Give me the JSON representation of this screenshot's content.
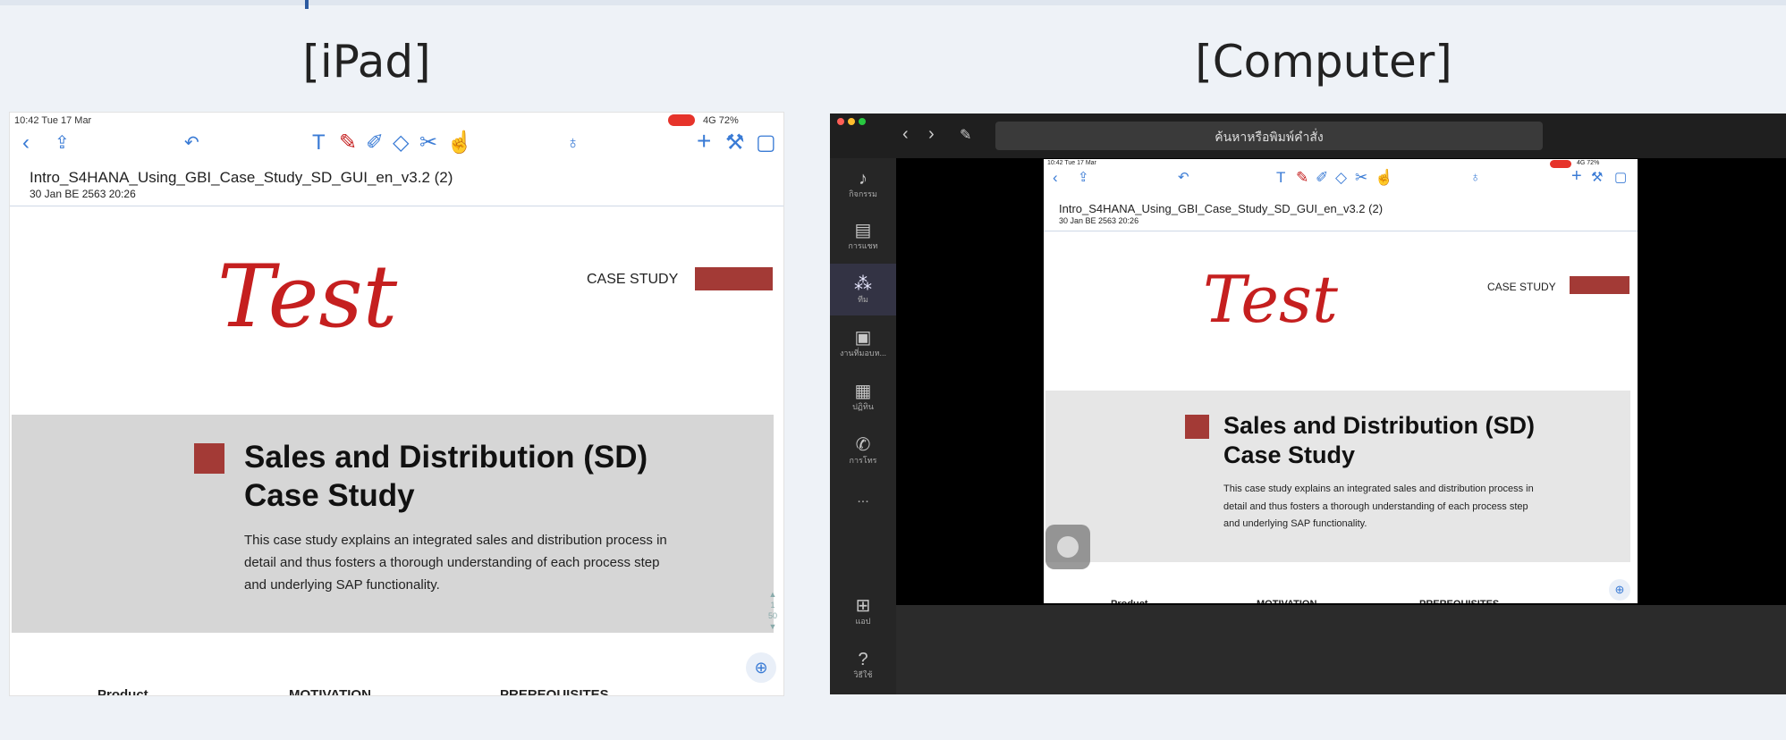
{
  "headings": {
    "ipad": "[iPad]",
    "computer": "[Computer]"
  },
  "ipad": {
    "status_time": "10:42  Tue 17 Mar",
    "status_right": "4G 72%",
    "doc_title": "Intro_S4HANA_Using_GBI_Case_Study_SD_GUI_en_v3.2 (2)",
    "doc_date": "30 Jan BE 2563 20:26",
    "handwriting": "Test",
    "case_study_label": "CASE STUDY",
    "title_line1": "Sales and Distribution (SD)",
    "title_line2": "Case Study",
    "body_line1": "This case study explains an integrated sales and distribution process in",
    "body_line2": "detail and thus fosters a thorough understanding of each process step",
    "body_line3": "and underlying SAP functionality.",
    "page_indicator_top": "1",
    "page_indicator_bottom": "50",
    "footer_col1": "Product",
    "footer_col2": "MOTIVATION",
    "footer_col3": "PREREQUISITES"
  },
  "teams": {
    "search_placeholder": "ค้นหาหรือพิมพ์คำสั่ง",
    "sidebar": [
      {
        "icon": "bell-icon",
        "label": "กิจกรรม"
      },
      {
        "icon": "chat-icon",
        "label": "การแชท"
      },
      {
        "icon": "teams-icon",
        "label": "ทีม"
      },
      {
        "icon": "assignments-icon",
        "label": "งานที่มอบห..."
      },
      {
        "icon": "calendar-icon",
        "label": "ปฏิทิน"
      },
      {
        "icon": "phone-icon",
        "label": "การโทร"
      },
      {
        "icon": "more-icon",
        "label": "..."
      },
      {
        "icon": "apps-icon",
        "label": "แอป"
      },
      {
        "icon": "help-icon",
        "label": "วิธีใช้"
      }
    ]
  },
  "colors": {
    "accent_red": "#a33a36",
    "ink_red": "#c51f1f",
    "ios_blue": "#3a7bd5",
    "teams_dark": "#1f1f1f"
  }
}
